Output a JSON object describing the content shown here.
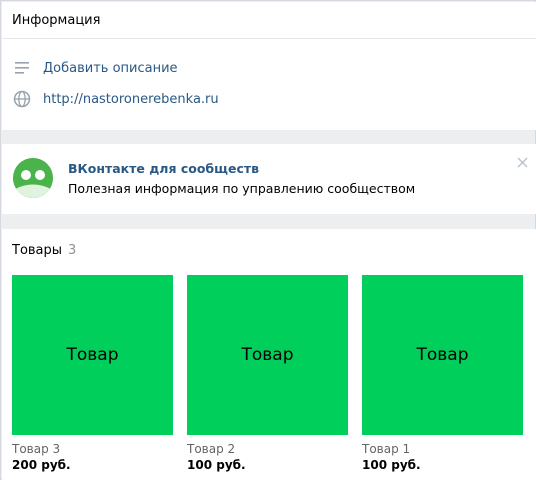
{
  "info": {
    "title": "Информация",
    "add_description": "Добавить описание",
    "website": "http://nastoronerebenka.ru",
    "icons": {
      "description": "lines-icon",
      "website": "globe-icon"
    }
  },
  "promo": {
    "title": "ВКонтакте для сообществ",
    "text": "Полезная информация по управлению сообществом",
    "icons": {
      "logo": "community-app-icon",
      "close": "close-icon"
    }
  },
  "goods": {
    "title": "Товары",
    "count": "3",
    "items": [
      {
        "thumb_label": "Товар",
        "name": "Товар 3",
        "price": "200 руб."
      },
      {
        "thumb_label": "Товар",
        "name": "Товар 2",
        "price": "100 руб."
      },
      {
        "thumb_label": "Товар",
        "name": "Товар 1",
        "price": "100 руб."
      }
    ]
  },
  "colors": {
    "link": "#2a5885",
    "product_green": "#00cf5c",
    "logo_green": "#4bb34b",
    "page_bg": "#edeef0"
  }
}
